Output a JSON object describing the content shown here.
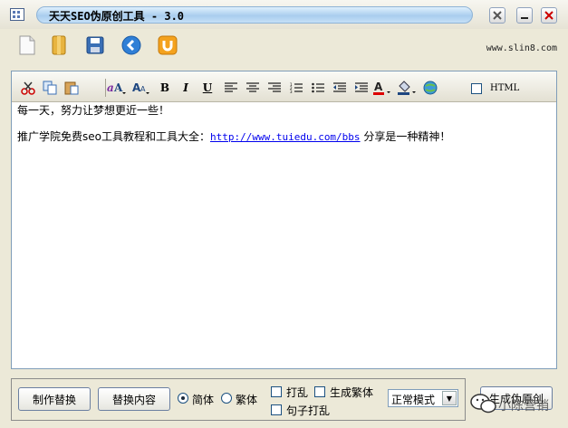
{
  "window": {
    "title": "天天SEO伪原创工具 - 3.0",
    "buttons": {
      "settings": "✕",
      "minimize": "—",
      "close": "✕"
    }
  },
  "toolbar": {
    "icons": [
      "new-file-icon",
      "open-book-icon",
      "save-disk-icon",
      "back-arrow-icon",
      "undo-icon"
    ],
    "site": "www.slin8.com"
  },
  "format_bar": {
    "bold": "B",
    "italic": "I",
    "underline": "U",
    "html_label": "HTML"
  },
  "editor": {
    "line1": "每一天，努力让梦想更近一些！",
    "line2_prefix": "推广学院免费seo工具教程和工具大全：",
    "line2_link": "http://www.tuiedu.com/bbs",
    "line2_suffix": " 分享是一种精神！"
  },
  "bottom": {
    "make_replace": "制作替换",
    "replace_content": "替换内容",
    "radio_simplified": "简体",
    "radio_traditional": "繁体",
    "shuffle": "打乱",
    "gen_traditional": "生成繁体",
    "sentence_shuffle": "句子打乱",
    "mode_selected": "正常模式",
    "generate": "生成伪原创"
  },
  "watermark": "小陈营销",
  "colors": {
    "title_bar": "#a9cdee",
    "accent": "#1c5180",
    "link": "#0000ee"
  }
}
